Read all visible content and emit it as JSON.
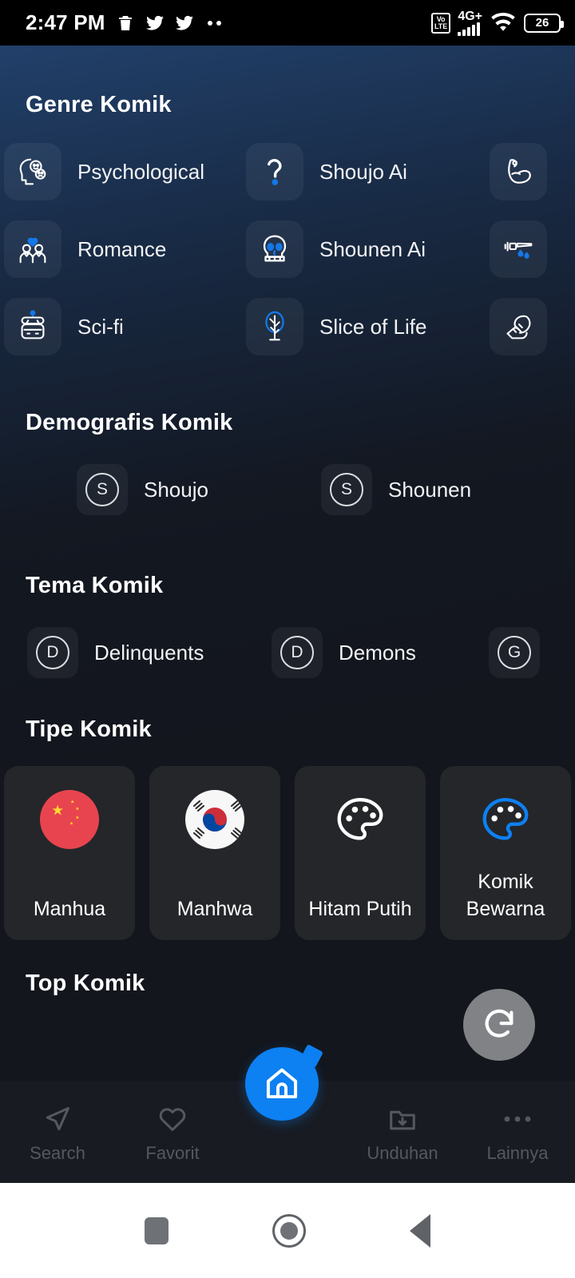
{
  "status_bar": {
    "time": "2:47 PM",
    "left_icons": [
      "trash-icon",
      "twitter-icon",
      "twitter-icon",
      "more-dots-icon"
    ],
    "volte_line1": "Vo",
    "volte_line2": "LTE",
    "network": "4G+",
    "signal_bars": 5,
    "wifi": "wifi-icon",
    "battery_level": "26"
  },
  "sections": {
    "genre": {
      "title": "Genre Komik",
      "items": [
        {
          "label": "Psychological",
          "icon": "psychological-head-icon"
        },
        {
          "label": "Shoujo Ai",
          "icon": "question-mark-icon"
        },
        {
          "label": "",
          "icon": "muscle-arm-icon"
        },
        {
          "label": "Romance",
          "icon": "couple-heart-icon"
        },
        {
          "label": "Shounen Ai",
          "icon": "skull-icon"
        },
        {
          "label": "",
          "icon": "bloody-sword-icon"
        },
        {
          "label": "Sci-fi",
          "icon": "robot-icon"
        },
        {
          "label": "Slice of Life",
          "icon": "tree-icon"
        },
        {
          "label": "",
          "icon": "hand-flame-icon"
        }
      ]
    },
    "demographics": {
      "title": "Demografis Komik",
      "items": [
        {
          "label": "Shoujo",
          "initial": "S"
        },
        {
          "label": "Shounen",
          "initial": "S"
        }
      ]
    },
    "theme": {
      "title": "Tema Komik",
      "items": [
        {
          "label": "Delinquents",
          "initial": "D"
        },
        {
          "label": "Demons",
          "initial": "D"
        },
        {
          "label": "",
          "initial": "G"
        }
      ]
    },
    "type": {
      "title": "Tipe Komik",
      "items": [
        {
          "label": "Manhua",
          "icon": "china-flag-icon"
        },
        {
          "label": "Manhwa",
          "icon": "korea-flag-icon"
        },
        {
          "label": "Hitam Putih",
          "icon": "palette-white-icon"
        },
        {
          "label": "Komik Bewarna",
          "icon": "palette-blue-icon"
        }
      ]
    },
    "top": {
      "title": "Top Komik",
      "refresh_icon": "refresh-icon"
    }
  },
  "bottom_nav": {
    "items": [
      {
        "label": "Search",
        "icon": "send-cursor-icon",
        "active": false
      },
      {
        "label": "Favorit",
        "icon": "heart-icon",
        "active": false
      },
      {
        "label": "",
        "icon": "home-icon",
        "active": true
      },
      {
        "label": "Unduhan",
        "icon": "folder-download-icon",
        "active": false
      },
      {
        "label": "Lainnya",
        "icon": "more-dots-icon",
        "active": false
      }
    ]
  },
  "android_nav": {
    "recents": "square-icon",
    "home": "circle-icon",
    "back": "triangle-back-icon"
  },
  "colors": {
    "accent_blue": "#0d80f2",
    "background": "#13161d",
    "nav_background": "#181b22",
    "tile": "rgba(255,255,255,.055)",
    "card": "#242629",
    "muted_text": "#55585f",
    "fab_gray": "#808285"
  }
}
